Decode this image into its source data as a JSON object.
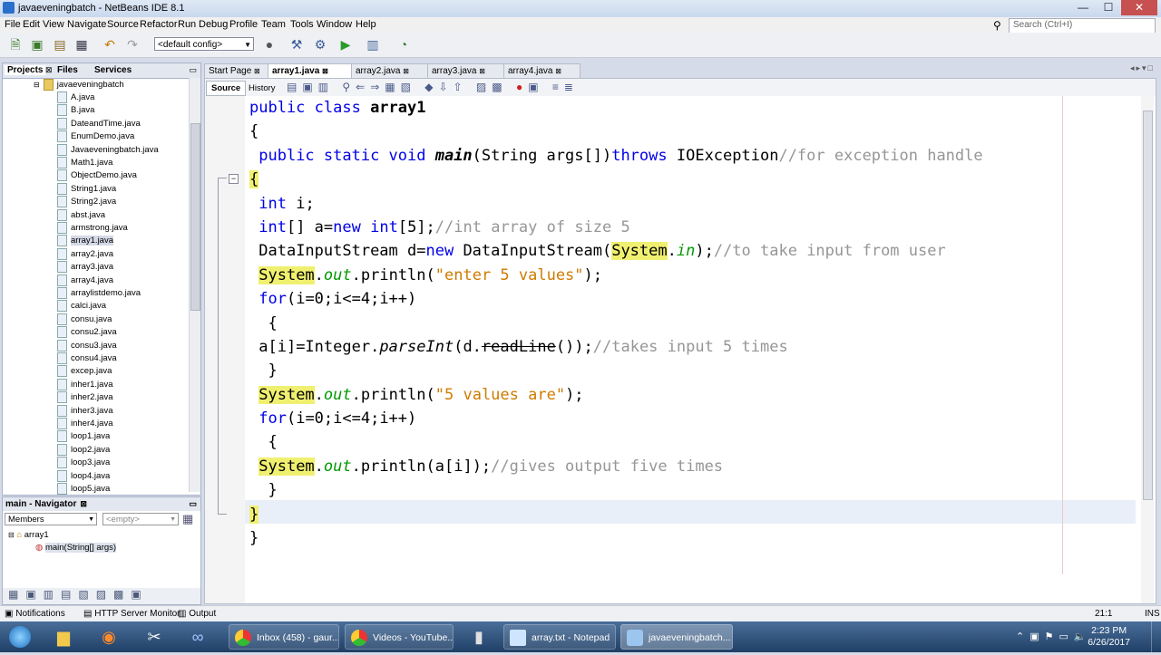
{
  "window": {
    "title": "javaeveningbatch - NetBeans IDE 8.1"
  },
  "window_buttons": {
    "minimize": "—",
    "maximize": "☐",
    "close": "✕"
  },
  "menu": [
    "File",
    "Edit",
    "View",
    "Navigate",
    "Source",
    "Refactor",
    "Run",
    "Debug",
    "Profile",
    "Team",
    "Tools",
    "Window",
    "Help"
  ],
  "search": {
    "placeholder": "Search (Ctrl+I)"
  },
  "toolbar": {
    "config": "<default config>"
  },
  "left_tabs": [
    "Projects",
    "Files",
    "Services"
  ],
  "project": {
    "root": "javaeveningbatch",
    "files": [
      "A.java",
      "B.java",
      "DateandTime.java",
      "EnumDemo.java",
      "Javaeveningbatch.java",
      "Math1.java",
      "ObjectDemo.java",
      "String1.java",
      "String2.java",
      "abst.java",
      "armstrong.java",
      "array1.java",
      "array2.java",
      "array3.java",
      "array4.java",
      "arraylistdemo.java",
      "calci.java",
      "consu.java",
      "consu2.java",
      "consu3.java",
      "consu4.java",
      "excep.java",
      "inher1.java",
      "inher2.java",
      "inher3.java",
      "inher4.java",
      "loop1.java",
      "loop2.java",
      "loop3.java",
      "loop4.java",
      "loop5.java"
    ],
    "selected": "array1.java"
  },
  "navigator": {
    "title": "main - Navigator",
    "filter": "Members",
    "empty": "<empty>",
    "class": "array1",
    "method": "main(String[] args)"
  },
  "editor_tabs": [
    "Start Page",
    "array1.java",
    "array2.java",
    "array3.java",
    "array4.java"
  ],
  "active_tab": "array1.java",
  "editor_modes": {
    "source": "Source",
    "history": "History"
  },
  "code": {
    "l1": {
      "kw": "public class ",
      "name": "array1"
    },
    "l2": "{",
    "l3": {
      "kw1": "public static void ",
      "method": "main",
      "args": "(String args[])",
      "kw2": "throws",
      "exc": " IOException",
      "comment": "//for exception handle"
    },
    "l4": "{",
    "l5": {
      "kw": "int",
      "rest": " i;"
    },
    "l6": {
      "kw1": "int",
      "a": "[] a=",
      "kw2": "new",
      "sp": " ",
      "kw3": "int",
      "b": "[5];",
      "comment": "//int array of size 5"
    },
    "l7": {
      "a": "DataInputStream d=",
      "kw": "new",
      "b": " DataInputStream(",
      "sys": "System",
      "dot": ".",
      "in": "in",
      "c": ");",
      "comment": "//to take input from user"
    },
    "l8": {
      "sys": "System",
      "dot": ".",
      "out": "out",
      "a": ".println(",
      "str": "\"enter 5 values\"",
      "b": ");"
    },
    "l9": {
      "kw": "for",
      "rest": "(i=0;i<=4;i++)"
    },
    "l10": "{",
    "l11": {
      "a": "a[i]=Integer.",
      "parse": "parseInt",
      "b": "(d.",
      "rl": "readLine",
      "c": "());",
      "comment": "//takes input 5 times"
    },
    "l12": "}",
    "l13": {
      "sys": "System",
      "dot": ".",
      "out": "out",
      "a": ".println(",
      "str": "\"5 values are\"",
      "b": ");"
    },
    "l14": {
      "kw": "for",
      "rest": "(i=0;i<=4;i++)"
    },
    "l15": "{",
    "l16": {
      "sys": "System",
      "dot": ".",
      "out": "out",
      "a": ".println(a[i]);",
      "comment": "//gives output five times"
    },
    "l17": "}",
    "l18": "}",
    "l19": "}"
  },
  "status": {
    "notifications": "Notifications",
    "http": "HTTP Server Monitor",
    "output": "Output",
    "position": "21:1",
    "mode": "INS"
  },
  "taskbar": {
    "tasks": [
      "Inbox (458) - gaur...",
      "Videos - YouTube...",
      "array.txt - Notepad",
      "javaeveningbatch..."
    ],
    "time": "2:23 PM",
    "date": "6/26/2017"
  }
}
